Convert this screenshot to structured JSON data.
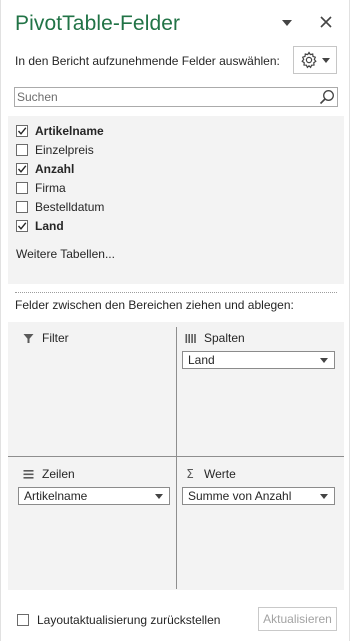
{
  "header": {
    "title": "PivotTable-Felder",
    "subtitle": "In den Bericht aufzunehmende Felder auswählen:"
  },
  "search": {
    "placeholder": "Suchen"
  },
  "fields": [
    {
      "label": "Artikelname",
      "checked": true
    },
    {
      "label": "Einzelpreis",
      "checked": false
    },
    {
      "label": "Anzahl",
      "checked": true
    },
    {
      "label": "Firma",
      "checked": false
    },
    {
      "label": "Bestelldatum",
      "checked": false
    },
    {
      "label": "Land",
      "checked": true
    }
  ],
  "more_tables": "Weitere Tabellen...",
  "areas_caption": "Felder zwischen den Bereichen ziehen und ablegen:",
  "areas": {
    "filter": {
      "label": "Filter",
      "icon": "filter-icon",
      "items": []
    },
    "columns": {
      "label": "Spalten",
      "icon": "columns-icon",
      "items": [
        "Land"
      ]
    },
    "rows": {
      "label": "Zeilen",
      "icon": "rows-icon",
      "items": [
        "Artikelname"
      ]
    },
    "values": {
      "label": "Werte",
      "icon": "sigma-icon",
      "items": [
        "Summe von Anzahl"
      ]
    }
  },
  "footer": {
    "defer_label": "Layoutaktualisierung zurückstellen",
    "defer_checked": false,
    "update_button": "Aktualisieren",
    "update_enabled": false
  },
  "colors": {
    "title_green": "#217346",
    "panel_gray": "#f3f3f3"
  }
}
